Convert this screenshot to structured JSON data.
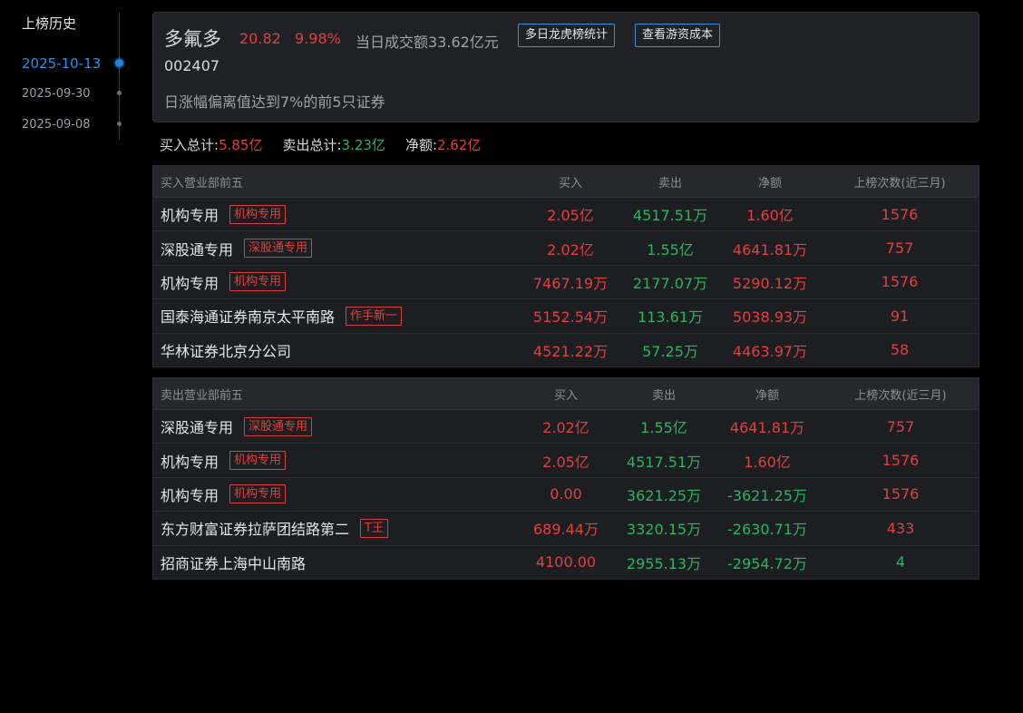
{
  "history": {
    "title": "上榜历史",
    "dates": [
      "2025-10-13",
      "2025-09-30",
      "2025-09-08"
    ]
  },
  "stock": {
    "name": "多氟多",
    "price": "20.82",
    "change": "9.98%",
    "turnover": "当日成交额33.62亿元",
    "code": "002407",
    "reason": "日涨幅偏离值达到7%的前5只证券",
    "btn_multi": "多日龙虎榜统计",
    "btn_cost": "查看游资成本"
  },
  "totals": {
    "buy_label": "买入总计:",
    "buy_value": "5.85亿",
    "sell_label": "卖出总计:",
    "sell_value": "3.23亿",
    "net_label": "净额:",
    "net_value": "2.62亿"
  },
  "buy_table": {
    "headers": [
      "买入营业部前五",
      "买入",
      "卖出",
      "净额",
      "上榜次数(近三月)"
    ],
    "rows": [
      {
        "name": "机构专用",
        "tag": "机构专用",
        "buy": "2.05亿",
        "sell": "4517.51万",
        "net": "1.60亿",
        "count": "1576"
      },
      {
        "name": "深股通专用",
        "tag": "深股通专用",
        "buy": "2.02亿",
        "sell": "1.55亿",
        "net": "4641.81万",
        "count": "757"
      },
      {
        "name": "机构专用",
        "tag": "机构专用",
        "buy": "7467.19万",
        "sell": "2177.07万",
        "net": "5290.12万",
        "count": "1576"
      },
      {
        "name": "国泰海通证券南京太平南路",
        "tag": "作手新一",
        "buy": "5152.54万",
        "sell": "113.61万",
        "net": "5038.93万",
        "count": "91"
      },
      {
        "name": "华林证券北京分公司",
        "tag": "",
        "buy": "4521.22万",
        "sell": "57.25万",
        "net": "4463.97万",
        "count": "58"
      }
    ]
  },
  "sell_table": {
    "headers": [
      "卖出营业部前五",
      "买入",
      "卖出",
      "净额",
      "上榜次数(近三月)"
    ],
    "rows": [
      {
        "name": "深股通专用",
        "tag": "深股通专用",
        "buy": "2.02亿",
        "sell": "1.55亿",
        "net": "4641.81万",
        "count": "757",
        "net_color": "red",
        "count_color": "red"
      },
      {
        "name": "机构专用",
        "tag": "机构专用",
        "buy": "2.05亿",
        "sell": "4517.51万",
        "net": "1.60亿",
        "count": "1576",
        "net_color": "red",
        "count_color": "red"
      },
      {
        "name": "机构专用",
        "tag": "机构专用",
        "buy": "0.00",
        "sell": "3621.25万",
        "net": "-3621.25万",
        "count": "1576",
        "net_color": "green",
        "count_color": "red"
      },
      {
        "name": "东方财富证券拉萨团结路第二",
        "tag": "T王",
        "buy": "689.44万",
        "sell": "3320.15万",
        "net": "-2630.71万",
        "count": "433",
        "net_color": "green",
        "count_color": "red"
      },
      {
        "name": "招商证券上海中山南路",
        "tag": "",
        "buy": "4100.00",
        "sell": "2955.13万",
        "net": "-2954.72万",
        "count": "4",
        "net_color": "green",
        "count_color": "green"
      }
    ]
  },
  "colors": {
    "up": "#e0403e",
    "down": "#2ab55d",
    "accent": "#1f86e0"
  }
}
